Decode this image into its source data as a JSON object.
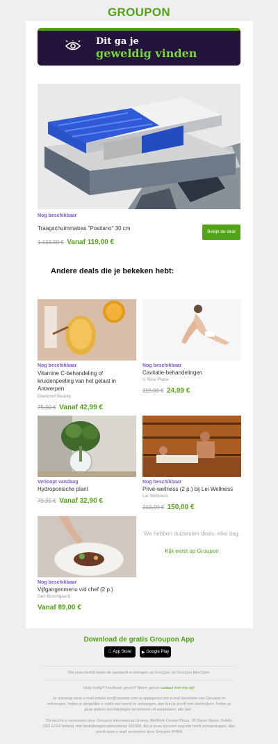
{
  "brand": {
    "logo": "GROUPON",
    "accent": "#53a318",
    "purple": "#7b5bd6"
  },
  "banner": {
    "line1": "Dit ga je",
    "line2": "geweldig vinden",
    "icon": "eye-icon"
  },
  "featured": {
    "availability": "Nog beschikbaar",
    "title": "Traagschuimmatras \"Positano\" 30 cm",
    "old_price": "1.193,00 €",
    "price": "Vanaf 119,00 €",
    "button": "Bekijk de deal"
  },
  "section_title": "Andere deals die je bekeken hebt:",
  "deals": [
    {
      "availability": "Nog beschikbaar",
      "title": "Vitamine C-behandeling of kruidenpeeling van het gelaat in Antwerpen",
      "merchant": "Diamond Beauty",
      "old_price": "75,00 €",
      "price": "Vanaf 42,99 €"
    },
    {
      "availability": "Nog beschikbaar",
      "title": "Cavitatie-behandelingen",
      "merchant": "U Nice Place",
      "old_price": "110,00 €",
      "price": "24,99 €"
    },
    {
      "availability": "Verloopt vandaag",
      "title": "Hydroponische plant",
      "merchant": "",
      "old_price": "79,95 €",
      "price": "Vanaf 32,90 €"
    },
    {
      "availability": "Nog beschikbaar",
      "title": "Privé-wellness (2 p.) bij Lei Wellness",
      "merchant": "Lei Wellness",
      "old_price": "210,00 €",
      "price": "150,00 €"
    },
    {
      "availability": "Nog beschikbaar",
      "title": "Vijfgangenmenu v/d chef (2 p.)",
      "merchant": "Den Boomgaard",
      "old_price": "",
      "price": "Vanaf 89,00 €"
    }
  ],
  "promo": {
    "text": "We hebben duizenden deals, elke dag.",
    "link": "Kijk eerst op Groupon"
  },
  "footer": {
    "download": "Download de gratis Groupon App",
    "appstore": "App Store",
    "googleplay": "Google Play",
    "merchant_line": "Om jouw bedrijf onder de aandacht te brengen op Groupon, bij Groupon Merchant.",
    "help_text": "Hulp nodig? Feedback geven? Neem gerust",
    "help_link": "contact met ons op!",
    "legal1": "Je ontvangt deze e-mail omdat xxx@ureader.com is opgegeven om e-mail berichten van Groupon te ontvangen. Indien je dergelijke e-mails niet wenst te ontvangen, dan kun je jezelf met uitschrijven. Indien je jouw andere inschrijvingen wil beheren of aanpassen, klik dan .",
    "legal2": "Dit bericht is verzonden door Groupon International Limited, WeWork Central Plaza, 36 Dame Street, Dublin D02 EF64 Ierland, met bedrijfsregistratienummer 501358. Als je jouw account nog niet heeft overgedragen, dan wordt deze e-mail verzonden door Groupon BVBA"
  }
}
